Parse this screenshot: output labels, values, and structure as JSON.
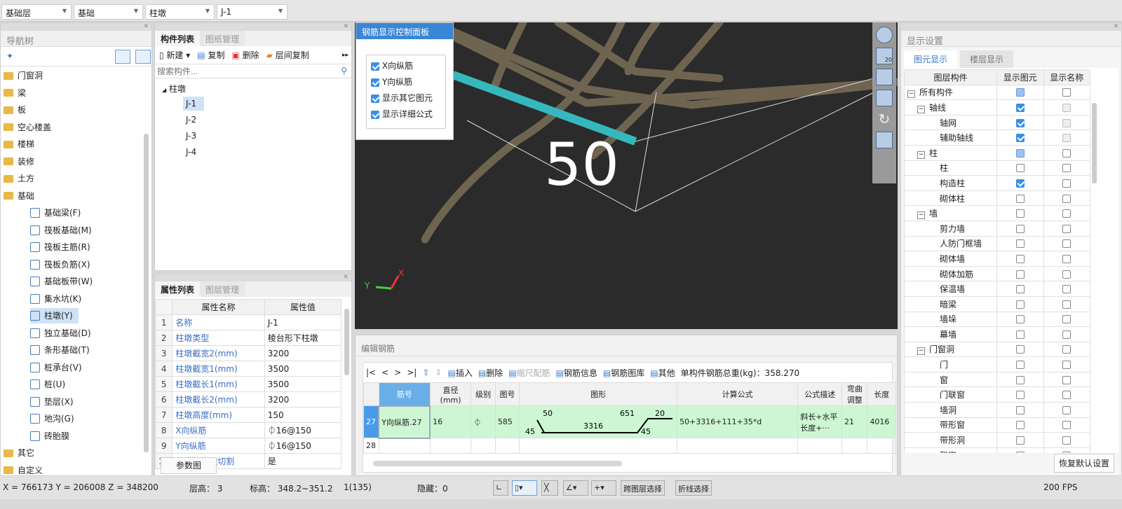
{
  "top_selectors": [
    "基础层",
    "基础",
    "柱墩",
    "J-1"
  ],
  "nav": {
    "title": "导航树",
    "items": [
      "门窗洞",
      "梁",
      "板",
      "空心楼盖",
      "楼梯",
      "装修",
      "土方",
      "基础"
    ],
    "sub_items": [
      "基础梁(F)",
      "筏板基础(M)",
      "筏板主筋(R)",
      "筏板负筋(X)",
      "基础板带(W)",
      "集水坑(K)",
      "柱墩(Y)",
      "独立基础(D)",
      "条形基础(T)",
      "桩承台(V)",
      "桩(U)",
      "垫层(X)",
      "地沟(G)",
      "砖胎膜"
    ],
    "selected": "柱墩(Y)",
    "tail_items": [
      "其它",
      "自定义"
    ]
  },
  "components": {
    "tabs": [
      "构件列表",
      "图纸管理"
    ],
    "toolbar": {
      "new": "新建",
      "copy": "复制",
      "delete": "删除",
      "floor_copy": "层间复制"
    },
    "search_placeholder": "搜索构件...",
    "root": "柱墩",
    "items": [
      "J-1",
      "J-2",
      "J-3",
      "J-4"
    ],
    "selected": "J-1"
  },
  "properties": {
    "tabs": [
      "属性列表",
      "图层管理"
    ],
    "headers": [
      "属性名称",
      "属性值"
    ],
    "rows": [
      [
        "1",
        "名称",
        "J-1"
      ],
      [
        "2",
        "柱墩类型",
        "棱台形下柱墩"
      ],
      [
        "3",
        "柱墩截宽2(mm)",
        "3200"
      ],
      [
        "4",
        "柱墩截宽1(mm)",
        "3500"
      ],
      [
        "5",
        "柱墩截长1(mm)",
        "3500"
      ],
      [
        "6",
        "柱墩截长2(mm)",
        "3200"
      ],
      [
        "7",
        "柱墩高度(mm)",
        "150"
      ],
      [
        "8",
        "X向纵筋",
        "⏀16@150"
      ],
      [
        "9",
        "Y向纵筋",
        "⏀16@150"
      ],
      [
        "10",
        "是否按板边切割",
        "是"
      ]
    ],
    "param_button": "参数图"
  },
  "control_panel": {
    "title": "钢筋显示控制面板",
    "options": [
      {
        "label": "X向纵筋",
        "checked": true
      },
      {
        "label": "Y向纵筋",
        "checked": true
      },
      {
        "label": "显示其它图元",
        "checked": true
      },
      {
        "label": "显示详细公式",
        "checked": true
      }
    ]
  },
  "view": {
    "label": "50",
    "mode_badge": "20",
    "axes": [
      "Y",
      "X"
    ]
  },
  "edit_rebar": {
    "title": "编辑钢筋",
    "nav": [
      "|<",
      "<",
      ">",
      ">|"
    ],
    "toolbar": [
      "插入",
      "删除",
      "缩尺配筋",
      "钢筋信息",
      "钢筋图库",
      "其他"
    ],
    "total_weight": "单构件钢筋总重(kg)：358.270",
    "headers": [
      "筋号",
      "直径(mm)",
      "级别",
      "图号",
      "图形",
      "计算公式",
      "公式描述",
      "弯曲调整",
      "长度"
    ],
    "rows": [
      {
        "idx": "27",
        "name": "Y向纵筋.27",
        "dia": "16",
        "grade": "⏀",
        "fig": "585",
        "shape": {
          "a": "50",
          "b": "651",
          "c": "20",
          "d": "3316",
          "e": "45",
          "f": "45"
        },
        "formula": "50+3316+111+35*d",
        "desc": "斜长+水平长度+···",
        "bend": "21",
        "length": "4016"
      },
      {
        "idx": "28"
      }
    ]
  },
  "display": {
    "title": "显示设置",
    "tabs": [
      "图元显示",
      "楼层显示"
    ],
    "headers": [
      "图层构件",
      "显示图元",
      "显示名称"
    ],
    "rows": [
      {
        "l": 0,
        "t": "所有构件",
        "g": true,
        "s": "part",
        "n": "off"
      },
      {
        "l": 1,
        "t": "轴线",
        "g": true,
        "s": "on",
        "n": "dis"
      },
      {
        "l": 2,
        "t": "轴网",
        "s": "on",
        "n": "dis"
      },
      {
        "l": 2,
        "t": "辅助轴线",
        "s": "on",
        "n": "dis"
      },
      {
        "l": 1,
        "t": "柱",
        "g": true,
        "s": "part",
        "n": "off"
      },
      {
        "l": 2,
        "t": "柱",
        "s": "off",
        "n": "off"
      },
      {
        "l": 2,
        "t": "构造柱",
        "s": "on",
        "n": "off"
      },
      {
        "l": 2,
        "t": "砌体柱",
        "s": "off",
        "n": "off"
      },
      {
        "l": 1,
        "t": "墙",
        "g": true,
        "s": "off",
        "n": "off"
      },
      {
        "l": 2,
        "t": "剪力墙",
        "s": "off",
        "n": "off"
      },
      {
        "l": 2,
        "t": "人防门框墙",
        "s": "off",
        "n": "off"
      },
      {
        "l": 2,
        "t": "砌体墙",
        "s": "off",
        "n": "off"
      },
      {
        "l": 2,
        "t": "砌体加筋",
        "s": "off",
        "n": "off"
      },
      {
        "l": 2,
        "t": "保温墙",
        "s": "off",
        "n": "off"
      },
      {
        "l": 2,
        "t": "暗梁",
        "s": "off",
        "n": "off"
      },
      {
        "l": 2,
        "t": "墙垛",
        "s": "off",
        "n": "off"
      },
      {
        "l": 2,
        "t": "幕墙",
        "s": "off",
        "n": "off"
      },
      {
        "l": 1,
        "t": "门窗洞",
        "g": true,
        "s": "off",
        "n": "off"
      },
      {
        "l": 2,
        "t": "门",
        "s": "off",
        "n": "off"
      },
      {
        "l": 2,
        "t": "窗",
        "s": "off",
        "n": "off"
      },
      {
        "l": 2,
        "t": "门联窗",
        "s": "off",
        "n": "off"
      },
      {
        "l": 2,
        "t": "墙洞",
        "s": "off",
        "n": "off"
      },
      {
        "l": 2,
        "t": "带形窗",
        "s": "off",
        "n": "off"
      },
      {
        "l": 2,
        "t": "带形洞",
        "s": "off",
        "n": "off"
      },
      {
        "l": 2,
        "t": "飘窗",
        "s": "off",
        "n": "off"
      }
    ],
    "restore_button": "恢复默认设置"
  },
  "status": {
    "coords": "X = 766173 Y = 206008 Z = 348200",
    "floor_height": "层高： 3",
    "elevation": "标高： 348.2~351.2",
    "count": "1(135)",
    "hidden": "隐藏：0",
    "cross_layer": "跨图层选择",
    "polyline": "折线选择",
    "fps": "200 FPS"
  }
}
